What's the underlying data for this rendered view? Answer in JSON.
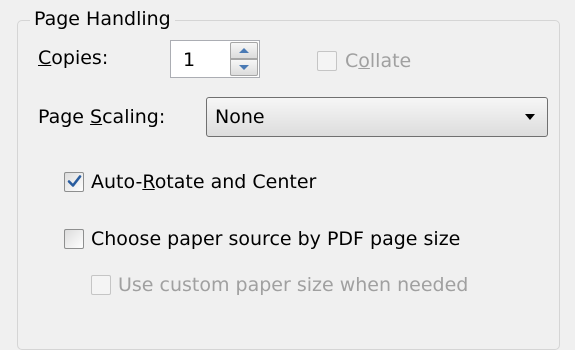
{
  "group": {
    "title": "Page Handling"
  },
  "copies": {
    "label_mnemonic": "C",
    "label_rest": "opies:",
    "value": "1"
  },
  "collate": {
    "label_pre": "C",
    "label_mnemonic": "o",
    "label_rest": "llate",
    "checked": false,
    "enabled": false
  },
  "page_scaling": {
    "label_pre": "Page ",
    "label_mnemonic": "S",
    "label_rest": "caling:",
    "selected": "None"
  },
  "auto_rotate": {
    "label_pre": "Auto-",
    "label_mnemonic": "R",
    "label_rest": "otate and Center",
    "checked": true
  },
  "paper_source": {
    "label": "Choose paper source by PDF page size",
    "checked": false
  },
  "custom_paper": {
    "label": "Use custom paper size when needed",
    "checked": false,
    "enabled": false
  },
  "icons": {
    "spin_up": "triangle-up-icon",
    "spin_down": "triangle-down-icon",
    "dropdown": "triangle-down-icon",
    "check": "checkmark-icon"
  },
  "colors": {
    "background": "#f0f0f0",
    "check_blue": "#2a5d9f",
    "spin_arrow": "#4a7ab5",
    "disabled_text": "#a0a0a0"
  }
}
